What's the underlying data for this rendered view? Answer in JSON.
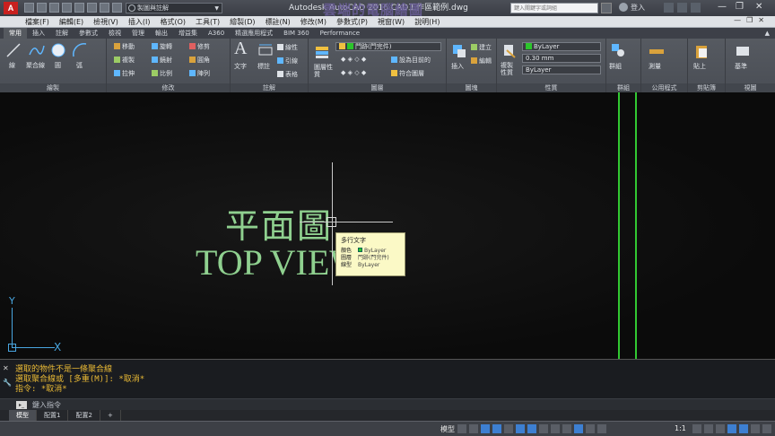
{
  "titlebar": {
    "app_logo": "A",
    "workspace": "製圖與註解",
    "window_title": "Autodesk AutoCAD 2016  CAD工作區範例.dwg",
    "watermark": "雲端的電腦繪圖",
    "search_placeholder": "鍵入關鍵字或詞組",
    "login_label": "登入",
    "minimize": "—",
    "restore": "❐",
    "close": "✕"
  },
  "menubar": {
    "items": [
      "檔案(F)",
      "編輯(E)",
      "檢視(V)",
      "插入(I)",
      "格式(O)",
      "工具(T)",
      "繪製(D)",
      "標註(N)",
      "修改(M)",
      "參數式(P)",
      "視窗(W)",
      "說明(H)"
    ],
    "doc_controls": "—❐✕"
  },
  "ribbon_tabs": {
    "items": [
      "常用",
      "插入",
      "註解",
      "參數式",
      "檢視",
      "管理",
      "輸出",
      "增益集",
      "A360",
      "精選應用程式",
      "BIM 360",
      "Performance"
    ],
    "active": "常用",
    "minimize": "▲"
  },
  "ribbon": {
    "draw": {
      "title": "繪製",
      "line": "線",
      "polyline": "聚合線",
      "circle": "圓",
      "arc": "弧"
    },
    "modify": {
      "title": "修改",
      "move": "移動",
      "rotate": "旋轉",
      "trim": "修剪",
      "copy": "複製",
      "mirror": "鏡射",
      "fillet": "圓角",
      "stretch": "拉伸",
      "scale": "比例",
      "array": "陣列"
    },
    "annotation": {
      "title": "註解",
      "text": "文字",
      "dimension": "標註",
      "leader": "引線",
      "table": "表格",
      "linear": "線性"
    },
    "layers": {
      "title": "圖層",
      "layer_props": "圖層性質",
      "current_layer": "門跡(門完件)",
      "make_current": "設為目前的",
      "match_layer": "符合圖層"
    },
    "block": {
      "title": "圖塊",
      "insert": "插入",
      "create": "建立",
      "edit": "編輯"
    },
    "properties": {
      "title": "性質",
      "match": "複製性質",
      "color": "ByLayer",
      "lineweight": "0.30 mm",
      "linetype": "ByLayer"
    },
    "groups": {
      "title": "群組",
      "group": "群組"
    },
    "utilities": {
      "title": "公用程式",
      "measure": "測量"
    },
    "clipboard": {
      "title": "剪貼簿",
      "paste": "貼上"
    },
    "view": {
      "title": "視圖",
      "base": "基準"
    }
  },
  "viewport": {
    "plan_cn": "平面圖",
    "plan_en": "TOP VIEW"
  },
  "tooltip": {
    "title": "多行文字",
    "rows": [
      {
        "key": "顏色",
        "value": "ByLayer"
      },
      {
        "key": "圖層",
        "value": "門跡(門完件)"
      },
      {
        "key": "線型",
        "value": "ByLayer"
      }
    ]
  },
  "ucs": {
    "y_label": "Y",
    "x_label": "X"
  },
  "command": {
    "history": [
      "選取的物件不是一條聚合線",
      "選取聚合線或 [多重(M)]: *取消*",
      "指令: *取消*"
    ],
    "input_placeholder": "鍵入指令",
    "close_icon": "✕",
    "custom_icon": "🔧"
  },
  "layout_tabs": {
    "items": [
      "模型",
      "配置1",
      "配置2"
    ],
    "add": "+"
  },
  "statusbar": {
    "model": "模型",
    "scale": "1:1"
  },
  "colors": {
    "drawing_green": "#8fd08f",
    "border_green": "#32c832",
    "command_text": "#eaba35",
    "ucs_blue": "#49a6e0"
  }
}
